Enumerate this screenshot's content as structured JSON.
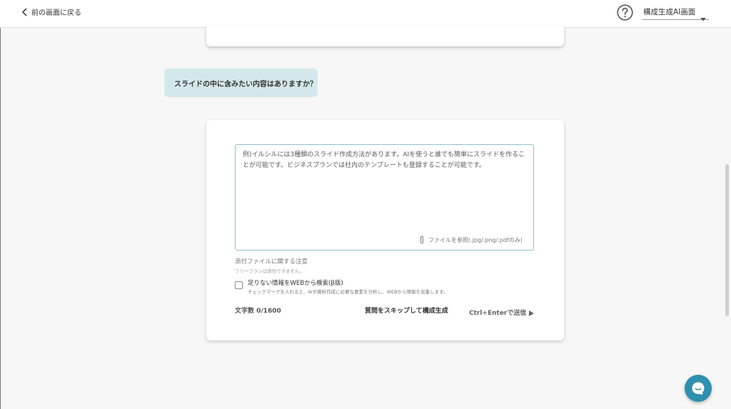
{
  "header": {
    "back_label": "前の画面に戻る",
    "mode_label": "構成生成AI画面"
  },
  "chat": {
    "question": "スライドの中に含みたい内容はありますか？"
  },
  "answer_form": {
    "placeholder": "例)イルシルには3種類のスライド作成方法があります。AIを使うと誰でも簡単にスライドを作ることが可能です。ビジネスプランでは社内のテンプレートも登録することが可能です。",
    "attach_label": "ファイルを参照(.jpg/.png/.pdfのみ)",
    "attachment_note_title": "添付ファイルに関する注意",
    "attachment_note_sub": "フリープランは添付できません。",
    "web_search_label": "足りない情報をWEBから検索(β版)",
    "web_search_desc": "チェックマークを入れると、AIが資料作成に必要な要素を分析し、WEBから情報を収集します。",
    "char_count": "文字数 0/1600",
    "skip_label": "質問をスキップして構成生成",
    "send_label": "Ctrl+Enterで送信"
  },
  "icons": {
    "back": "chevron-left-icon",
    "help": "question-circle-icon",
    "dropdown": "caret-down-icon",
    "attach": "paperclip-icon",
    "send": "triangle-right-icon",
    "chat": "chat-bubble-icon"
  },
  "colors": {
    "bubble": "#d4e8ec",
    "textarea_border": "#8fc0cf",
    "chat_button": "#2e8fae"
  }
}
